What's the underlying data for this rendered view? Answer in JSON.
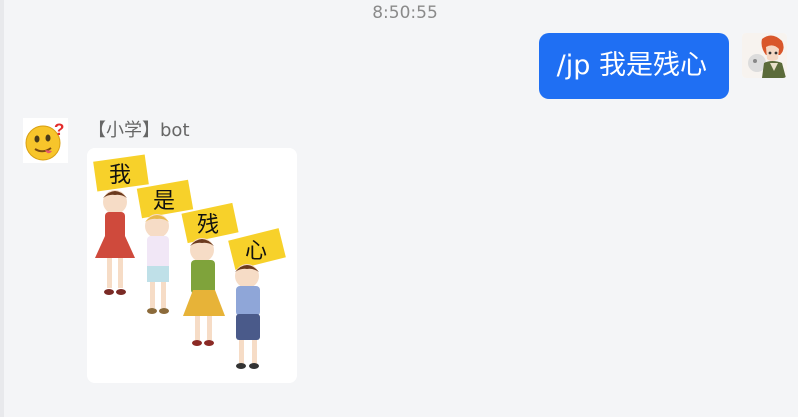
{
  "chat": {
    "timestamp": "8:50:55",
    "outgoing": {
      "text": "/jp 我是残心",
      "bubble_color": "#1f6ff3"
    },
    "incoming": {
      "sender_name": "【小学】bot",
      "image_words": [
        "我",
        "是",
        "残",
        "心"
      ]
    }
  }
}
